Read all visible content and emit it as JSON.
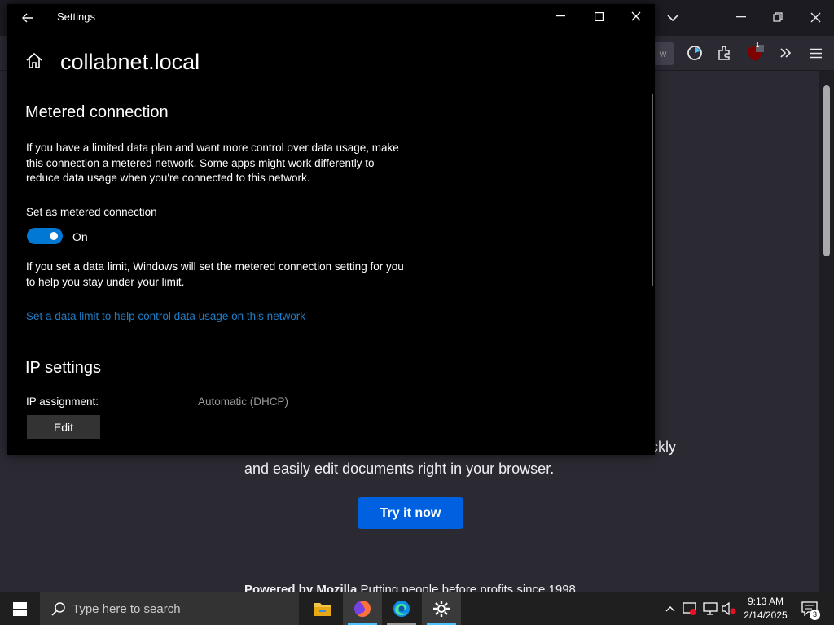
{
  "settings_window": {
    "title": "Settings",
    "network_name": "collabnet.local",
    "metered": {
      "heading": "Metered connection",
      "description": "If you have a limited data plan and want more control over data usage, make this connection a metered network. Some apps might work differently to reduce data usage when you're connected to this network.",
      "toggle_label": "Set as metered connection",
      "toggle_state": "On",
      "limit_text": "If you set a data limit, Windows will set the metered connection setting for you to help you stay under your limit.",
      "limit_link": "Set a data limit to help control data usage on this network"
    },
    "ip": {
      "heading": "IP settings",
      "assignment_label": "IP assignment:",
      "assignment_value": "Automatic (DHCP)",
      "edit_button": "Edit"
    }
  },
  "firefox_page": {
    "partial_text": "ckly",
    "subtext": "and easily edit documents right in your browser.",
    "try_button": "Try it now",
    "footer_bold": "Powered by Mozilla",
    "footer_rest": " Putting people before profits since 1998",
    "extension_badge": "1"
  },
  "taskbar": {
    "search_placeholder": "Type here to search",
    "time": "9:13 AM",
    "date": "2/14/2025",
    "notification_count": "3",
    "apps": [
      "file-explorer",
      "firefox",
      "edge",
      "settings"
    ]
  },
  "colors": {
    "accent": "#0078d4",
    "link": "#1e7ec8",
    "firefox_button": "#0061e0",
    "page_bg": "#2b2a33"
  }
}
